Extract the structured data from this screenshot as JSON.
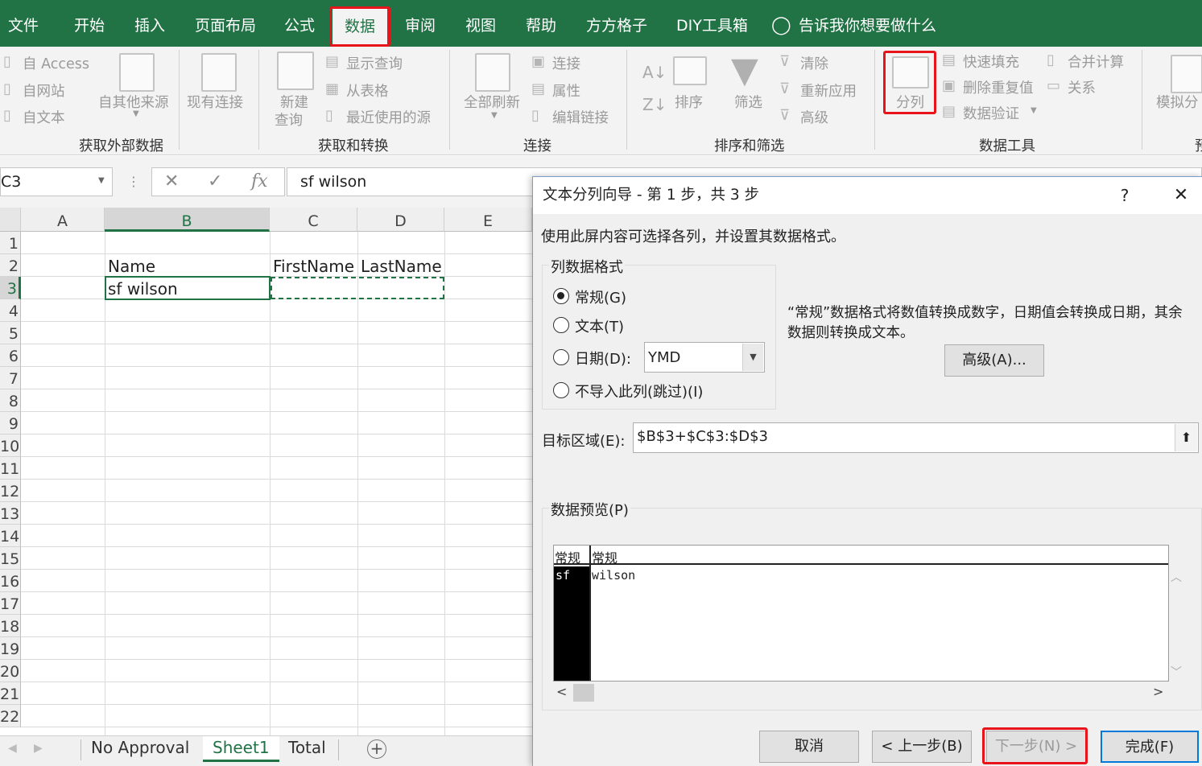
{
  "ribbon": {
    "tabs": [
      "文件",
      "开始",
      "插入",
      "页面布局",
      "公式",
      "数据",
      "审阅",
      "视图",
      "帮助",
      "方方格子",
      "DIY工具箱"
    ],
    "active_tab": "数据",
    "tell_me": "告诉我你想要做什么",
    "get_external": {
      "access": "自 Access",
      "web": "自网站",
      "text": "自文本",
      "other": "自其他来源",
      "existing": "现有连接",
      "label": "获取外部数据"
    },
    "get_transform": {
      "new_query_1": "新建",
      "new_query_2": "查询",
      "show_queries": "显示查询",
      "from_table": "从表格",
      "recent_sources": "最近使用的源",
      "label": "获取和转换"
    },
    "connections": {
      "refresh_all": "全部刷新",
      "connections": "连接",
      "properties": "属性",
      "edit_links": "编辑链接",
      "label": "连接"
    },
    "sort_filter": {
      "sort": "排序",
      "filter": "筛选",
      "clear": "清除",
      "reapply": "重新应用",
      "advanced": "高级",
      "label": "排序和筛选"
    },
    "data_tools": {
      "text_to_columns": "分列",
      "flash_fill": "快速填充",
      "remove_duplicates": "删除重复值",
      "data_validation": "数据验证",
      "consolidate": "合并计算",
      "relationships": "关系",
      "label": "数据工具"
    },
    "forecast": {
      "what_if": "模拟分",
      "label_fragment": "预"
    }
  },
  "formula_bar": {
    "name_box": "C3",
    "fx": "fx",
    "value": "sf wilson"
  },
  "grid": {
    "columns": [
      "A",
      "B",
      "C",
      "D",
      "E"
    ],
    "rows": [
      "1",
      "2",
      "3",
      "4",
      "5",
      "6",
      "7",
      "8",
      "9",
      "10",
      "11",
      "12",
      "13",
      "14",
      "15",
      "16",
      "17",
      "18",
      "19",
      "20",
      "21",
      "22"
    ],
    "cells": {
      "B2": "Name",
      "C2": "FirstName",
      "D2": "LastName",
      "B3": "sf wilson"
    }
  },
  "sheets": {
    "tabs": [
      "No Approval",
      "Sheet1",
      "Total"
    ],
    "active": "Sheet1"
  },
  "dialog": {
    "title": "文本分列向导 - 第 1 步，共 3 步",
    "help": "?",
    "close": "✕",
    "instruction": "使用此屏内容可选择各列，并设置其数据格式。",
    "column_format_label": "列数据格式",
    "options": {
      "general": "常规(G)",
      "text": "文本(T)",
      "date": "日期(D):",
      "skip": "不导入此列(跳过)(I)"
    },
    "selected_option": "常规(G)",
    "date_format": "YMD",
    "description_line1": "“常规”数据格式将数值转换成数字，日期值会转换成日期，其余",
    "description_line2": "数据则转换成文本。",
    "advanced_button": "高级(A)...",
    "destination_label": "目标区域(E):",
    "destination_value": "$B$3+$C$3:$D$3",
    "preview_label": "数据预览(P)",
    "preview_headers": [
      "常规",
      "常规"
    ],
    "preview_values": [
      "sf",
      "wilson"
    ],
    "buttons": {
      "cancel": "取消",
      "back": "< 上一步(B)",
      "next": "下一步(N) >",
      "finish": "完成(F)"
    }
  },
  "colors": {
    "excel_green": "#217346",
    "highlight_red": "#e8141b",
    "dialog_focus_blue": "#0078d7"
  }
}
